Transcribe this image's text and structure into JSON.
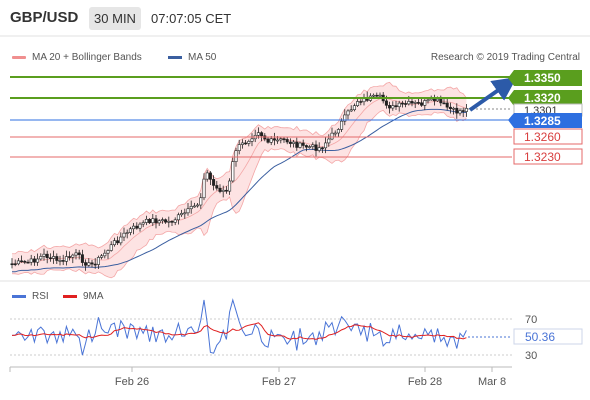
{
  "header": {
    "symbol": "GBP/USD",
    "timeframe": "30 MIN",
    "time": "07:07:05 CET"
  },
  "legend": {
    "bb_label": "MA 20 + Bollinger Bands",
    "ma50_label": "MA 50",
    "credit": "Research © 2019 Trading Central"
  },
  "levels": {
    "r2": "1.3350",
    "r1": "1.3320",
    "current": "1.3301",
    "pivot": "1.3285",
    "s1": "1.3260",
    "s2": "1.3230"
  },
  "rsi_panel": {
    "rsi_label": "RSI",
    "ma_label": "9MA",
    "level_70": "70",
    "level_30": "30",
    "value": "50.36"
  },
  "xaxis": {
    "labels": [
      "Feb 26",
      "Feb 27",
      "Feb 28",
      "Mar 8"
    ]
  },
  "colors": {
    "resistance": "#5a9e1e",
    "support": "#e4696a",
    "pivot": "#2e6fe0",
    "ma50": "#3b5fa0",
    "bb": "#f3a6a6",
    "rsi": "#4a74d6",
    "rsi_ma": "#e02020",
    "arrow": "#2c5aa8"
  }
}
